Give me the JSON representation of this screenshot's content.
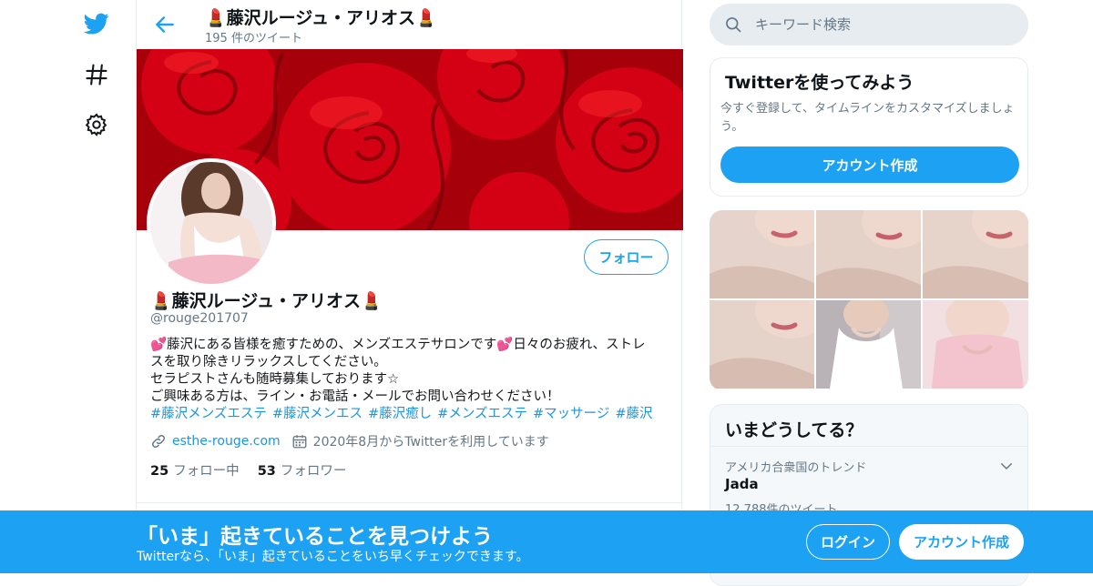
{
  "nav": {
    "icons": [
      "twitter-bird-icon",
      "hashtag-icon",
      "gear-icon"
    ]
  },
  "profile_header": {
    "title": "💄藤沢ルージュ・アリオス💄",
    "tweet_count": "195 件のツイート"
  },
  "profile": {
    "display_name": "💄藤沢ルージュ・アリオス💄",
    "handle": "@rouge201707",
    "follow_label": "フォロー",
    "bio_lines": [
      "💕藤沢にある皆様を癒すための、メンズエステサロンです💕日々のお疲れ、ストレ",
      "スを取り除きリラックスしてください。",
      "セラピストさんも随時募集しております☆",
      "ご興味ある方は、ライン・お電話・メールでお問い合わせください！"
    ],
    "hashtags": [
      "#藤沢メンズエステ",
      "#藤沢メンエス",
      "#藤沢癒し",
      "#メンズエステ",
      "#マッサージ",
      "#藤沢"
    ],
    "website": "esthe-rouge.com",
    "joined": "2020年8月からTwitterを利用しています",
    "following_count": "25",
    "following_label": "フォロー中",
    "followers_count": "53",
    "followers_label": "フォロワー"
  },
  "search": {
    "placeholder": "キーワード検索"
  },
  "signup_card": {
    "title": "Twitterを使ってみよう",
    "description": "今すぐ登録して、タイムラインをカスタマイズしましょう。",
    "button_label": "アカウント作成"
  },
  "trends": {
    "title": "いまどうしてる？",
    "items": [
      {
        "context": "アメリカ合衆国のトレンド",
        "name": "Jada",
        "count": "12,788件のツイート"
      }
    ]
  },
  "bottom_bar": {
    "title": "「いま」起きていることを見つけよう",
    "subtitle": "Twitterなら、「いま」起きていることをいち早くチェックできます。",
    "login_label": "ログイン",
    "signup_label": "アカウント作成"
  },
  "colors": {
    "accent": "#1da1f2",
    "link": "#1b95e0",
    "muted": "#657786",
    "banner": "#c8000f"
  }
}
